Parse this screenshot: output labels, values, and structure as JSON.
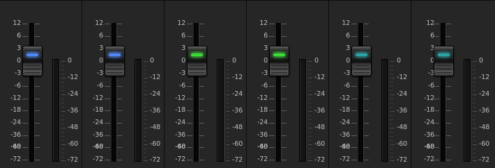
{
  "fader_scale": [
    "12",
    "6",
    "3",
    "0",
    "-3",
    "-6",
    "-12",
    "-18",
    "-24",
    "-36",
    "-48",
    "-60",
    "-72"
  ],
  "meter_scale": [
    "0",
    "-12",
    "-24",
    "-36",
    "-48",
    "-60",
    "-72"
  ],
  "channels": [
    {
      "fader_db": 0,
      "led_color": "#4f86f0"
    },
    {
      "fader_db": 0,
      "led_color": "#4f86f0"
    },
    {
      "fader_db": 0,
      "led_color": "#3fd93a"
    },
    {
      "fader_db": 0,
      "led_color": "#3fd93a"
    },
    {
      "fader_db": 0,
      "led_color": "#2fa3a3"
    },
    {
      "fader_db": 0,
      "led_color": "#2fa3a3"
    }
  ]
}
